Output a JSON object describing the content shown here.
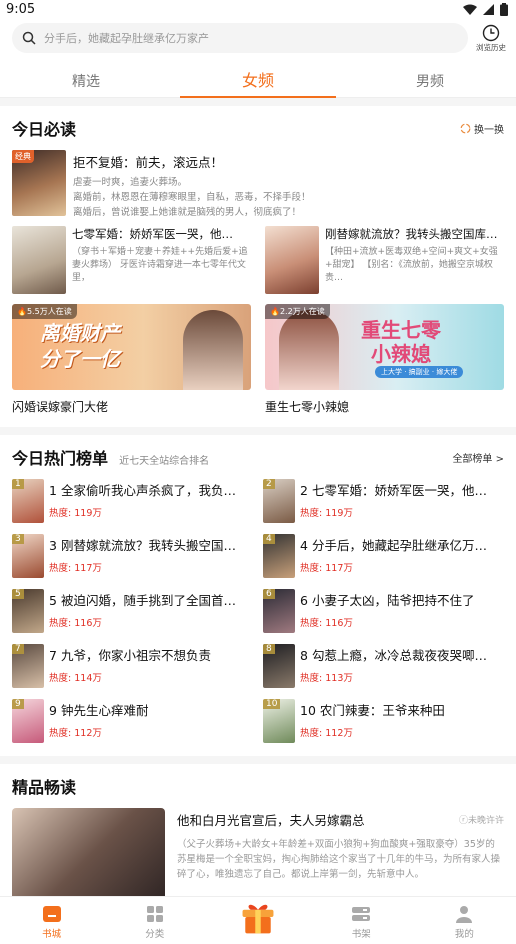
{
  "status": {
    "time": "9:05"
  },
  "search": {
    "placeholder": "分手后，她藏起孕肚继承亿万家产",
    "history_label": "浏览历史"
  },
  "tabs": [
    {
      "label": "精选"
    },
    {
      "label": "女频"
    },
    {
      "label": "男频"
    }
  ],
  "today": {
    "title": "今日必读",
    "refresh_label": "换一换",
    "featured": {
      "badge": "经典",
      "title": "拒不复婚：前夫，滚远点！",
      "lines": [
        "虐妻一时爽，追妻火葬场。",
        "离婚前，林恩恩在薄穆寒眼里，自私，恶毒，不择手段！",
        "离婚后，曾说谁娶上她谁就是脑残的男人，彻底疯了！"
      ]
    },
    "pair": [
      {
        "title": "七零军婚：娇娇军医一哭，他…",
        "desc": "（穿书＋军婚＋宠妻＋养娃++先婚后爱+追妻火葬场）\n牙医许诗霜穿进一本七零年代文里，"
      },
      {
        "title": "刚替嫁就流放？我转头搬空国库…",
        "desc": "【种田+流放+医毒双绝+空间+爽文+女强+甜宠】\n【别名：《流放前，她搬空京城权贵…"
      }
    ],
    "banners": [
      {
        "readers": "5.5万人在读",
        "art_line1": "离婚财产",
        "art_line2": "分了一亿",
        "title": "闪婚误嫁豪门大佬"
      },
      {
        "readers": "2.2万人在读",
        "art_line1": "重生七零",
        "art_line2": "小辣媳",
        "tagline": "上大学 · 搞副业 · 嫁大佬",
        "title": "重生七零小辣媳"
      }
    ]
  },
  "hot": {
    "title": "今日热门榜单",
    "subtitle": "近七天全站综合排名",
    "all_label": "全部榜单 >",
    "heat_label": "热度:",
    "items": [
      {
        "rank": "1",
        "title": "全家偷听我心声杀疯了，我负…",
        "heat": "119万"
      },
      {
        "rank": "2",
        "title": "七零军婚：娇娇军医一哭，他…",
        "heat": "119万"
      },
      {
        "rank": "3",
        "title": "刚替嫁就流放？我转头搬空国…",
        "heat": "117万"
      },
      {
        "rank": "4",
        "title": "分手后，她藏起孕肚继承亿万…",
        "heat": "117万"
      },
      {
        "rank": "5",
        "title": "被迫闪婚，随手挑到了全国首…",
        "heat": "116万"
      },
      {
        "rank": "6",
        "title": "小妻子太凶，陆爷把持不住了",
        "heat": "116万"
      },
      {
        "rank": "7",
        "title": "九爷，你家小祖宗不想负责",
        "heat": "114万"
      },
      {
        "rank": "8",
        "title": "勾惹上瘾，冰冷总裁夜夜哭唧…",
        "heat": "113万"
      },
      {
        "rank": "9",
        "title": "钟先生心痒难耐",
        "heat": "112万"
      },
      {
        "rank": "10",
        "title": "农门辣妻：王爷来种田",
        "heat": "112万"
      }
    ]
  },
  "premium": {
    "title": "精品畅读",
    "book": {
      "title": "他和白月光官宣后，夫人另嫁霸总",
      "tag": "未晚许许",
      "desc": "（父子火葬场+大龄女+年龄差+双面小狼狗+狗血酸爽+强取豪夺）35岁的苏星梅是一个全职宝妈，掏心掏肺给这个家当了十几年的牛马，为所有家人操碎了心，唯独遗忘了自己。都说上岸第一剑，先斩意中人。"
    }
  },
  "nav": [
    {
      "label": "书城"
    },
    {
      "label": "分类"
    },
    {
      "label": ""
    },
    {
      "label": "书架"
    },
    {
      "label": "我的"
    }
  ],
  "colors": {
    "accent": "#f36f1c",
    "heat": "#e02e24"
  }
}
